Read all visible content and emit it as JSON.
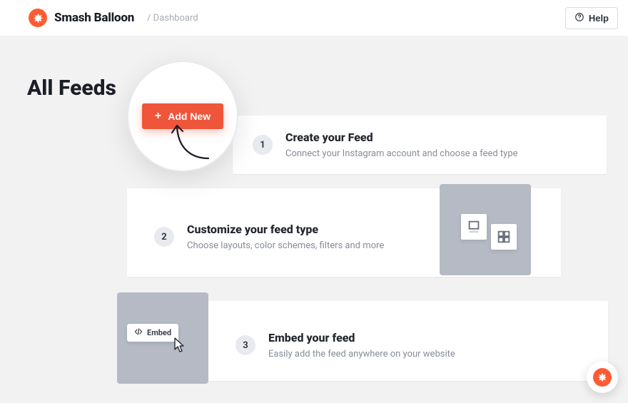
{
  "header": {
    "brand": "Smash Balloon",
    "breadcrumb": "/ Dashboard",
    "help_label": "Help"
  },
  "page": {
    "title": "All Feeds",
    "add_new_label": "Add New"
  },
  "steps": [
    {
      "num": "1",
      "title": "Create your Feed",
      "sub": "Connect your Instagram account and choose a feed type"
    },
    {
      "num": "2",
      "title": "Customize your feed type",
      "sub": "Choose layouts, color schemes, filters and more"
    },
    {
      "num": "3",
      "title": "Embed your feed",
      "sub": "Easily add the feed anywhere on your website"
    }
  ],
  "embed_chip_label": "Embed"
}
